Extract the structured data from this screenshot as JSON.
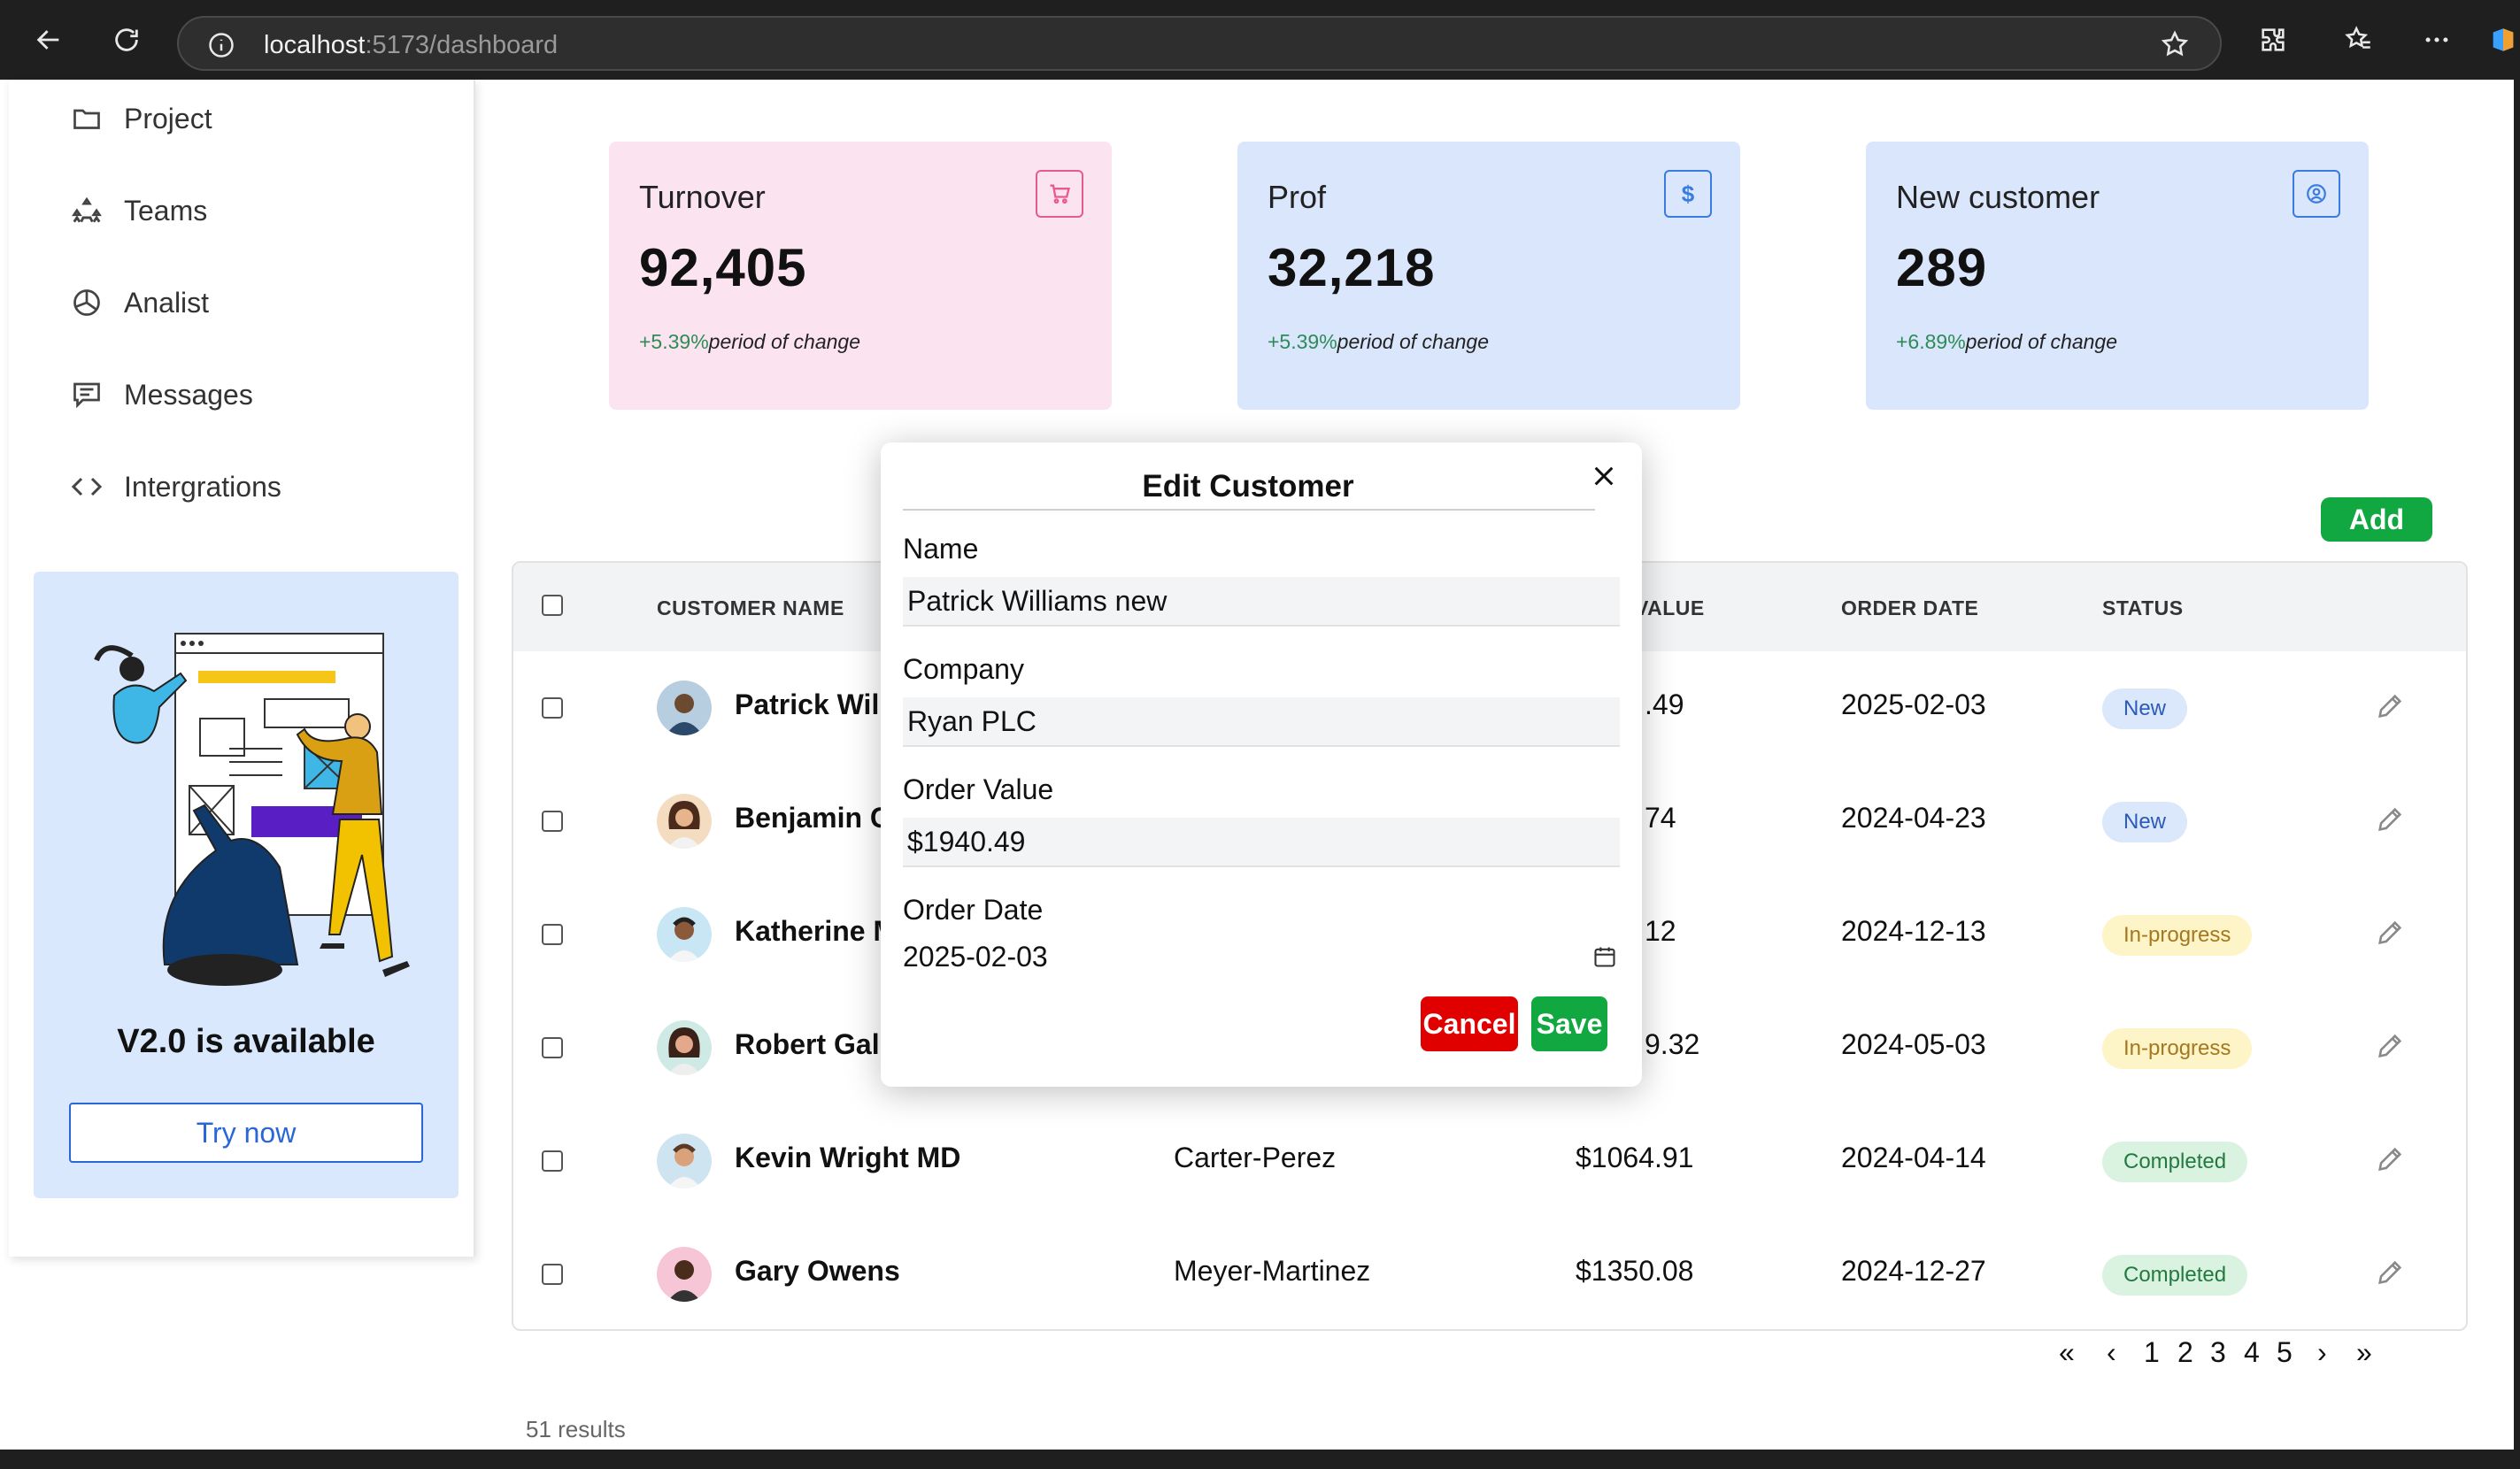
{
  "browser": {
    "url_host": "localhost",
    "url_path": ":5173/dashboard"
  },
  "sidebar": {
    "items": [
      {
        "label": "Project",
        "icon": "folder-icon"
      },
      {
        "label": "Teams",
        "icon": "teams-icon"
      },
      {
        "label": "Analist",
        "icon": "pie-chart-icon"
      },
      {
        "label": "Messages",
        "icon": "message-icon"
      },
      {
        "label": "Intergrations",
        "icon": "code-icon"
      }
    ],
    "promo": {
      "title": "V2.0 is available",
      "button": "Try now"
    }
  },
  "stats": [
    {
      "title": "Turnover",
      "value": "92,405",
      "change_pct": "+5.39%",
      "change_text": "period of change",
      "icon": "cart-icon",
      "color": "#fbe4ef"
    },
    {
      "title": "Prof",
      "value": "32,218",
      "change_pct": "+5.39%",
      "change_text": "period of change",
      "icon": "dollar-icon",
      "color": "#d9e6fb"
    },
    {
      "title": "New customer",
      "value": "289",
      "change_pct": "+6.89%",
      "change_text": "period of change",
      "icon": "user-circle-icon",
      "color": "#d9e6fb"
    }
  ],
  "add_button": "Add",
  "table": {
    "headers": {
      "name": "CUSTOMER NAME",
      "value": "R VALUE",
      "date": "ORDER DATE",
      "status": "STATUS"
    },
    "rows": [
      {
        "name": "Patrick Willi",
        "company": "",
        "value": ".49",
        "date": "2025-02-03",
        "status": "New",
        "status_type": "new"
      },
      {
        "name": "Benjamin C",
        "company": "",
        "value": "74",
        "date": "2024-04-23",
        "status": "New",
        "status_type": "new"
      },
      {
        "name": "Katherine M",
        "company": "",
        "value": "12",
        "date": "2024-12-13",
        "status": "In-progress",
        "status_type": "inprogress"
      },
      {
        "name": "Robert Galle",
        "company": "",
        "value": "9.32",
        "date": "2024-05-03",
        "status": "In-progress",
        "status_type": "inprogress"
      },
      {
        "name": "Kevin Wright MD",
        "company": "Carter-Perez",
        "value": "$1064.91",
        "date": "2024-04-14",
        "status": "Completed",
        "status_type": "completed"
      },
      {
        "name": "Gary Owens",
        "company": "Meyer-Martinez",
        "value": "$1350.08",
        "date": "2024-12-27",
        "status": "Completed",
        "status_type": "completed"
      }
    ]
  },
  "pagination": {
    "first": "«",
    "prev": "‹",
    "pages": [
      "1",
      "2",
      "3",
      "4",
      "5"
    ],
    "next": "›",
    "last": "»",
    "results": "51 results"
  },
  "modal": {
    "title": "Edit Customer",
    "name_label": "Name",
    "name_value": "Patrick Williams new",
    "company_label": "Company",
    "company_value": "Ryan PLC",
    "order_value_label": "Order Value",
    "order_value_value": "$1940.49",
    "order_date_label": "Order Date",
    "order_date_value": "2025-02-03",
    "cancel": "Cancel",
    "save": "Save"
  }
}
